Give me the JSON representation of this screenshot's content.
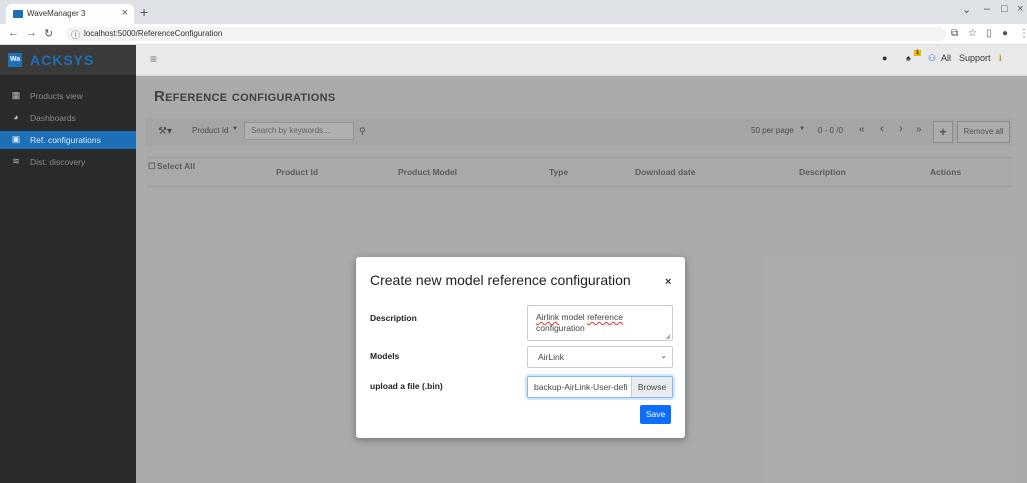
{
  "browser": {
    "tab_title": "WaveManager 3",
    "tab_close": "×",
    "new_tab": "+",
    "url": "localhost:5000/ReferenceConfiguration",
    "window_controls": [
      "⌄",
      "–",
      "□",
      "×"
    ]
  },
  "sidebar": {
    "brand": "ACKSYS",
    "logo_text": "Wa",
    "items": [
      {
        "label": "Products view",
        "icon": "grid-icon"
      },
      {
        "label": "Dashboards",
        "icon": "dashboard-icon"
      },
      {
        "label": "Ref. configurations",
        "icon": "clipboard-icon",
        "active": true
      },
      {
        "label": "Dist. discovery",
        "icon": "wifi-icon"
      }
    ]
  },
  "header": {
    "menu_icon": "hamburger-icon",
    "notification_badge": "1",
    "scope_label": "All",
    "support_label": "Support",
    "info_label": "i"
  },
  "page": {
    "title": "Reference configurations"
  },
  "toolbar": {
    "filter_field": "Product Id",
    "search_placeholder": "Search by keywords...",
    "per_page": "50 per page",
    "range": "0 - 0 /0",
    "first": "«",
    "prev": "‹",
    "next": "›",
    "last": "»",
    "add": "+",
    "remove_all": "Remove all"
  },
  "table": {
    "select_all": "Select All",
    "columns": [
      "Product Id",
      "Product Model",
      "Type",
      "Download date",
      "Description",
      "Actions"
    ]
  },
  "modal": {
    "title": "Create new model reference configuration",
    "close": "×",
    "description_label": "Description",
    "description_word1": "Airlink",
    "description_word2": "model",
    "description_word3": "reference",
    "description_word4": "configuration",
    "models_label": "Models",
    "models_value": "AirLink",
    "file_label": "upload a file (.bin)",
    "file_value": "backup-AirLink-User-defi",
    "browse_label": "Browse",
    "save_label": "Save"
  },
  "colors": {
    "accent": "#1d6fb8",
    "primary_button": "#0d6efd",
    "sidebar_bg": "#2a2a2a"
  }
}
